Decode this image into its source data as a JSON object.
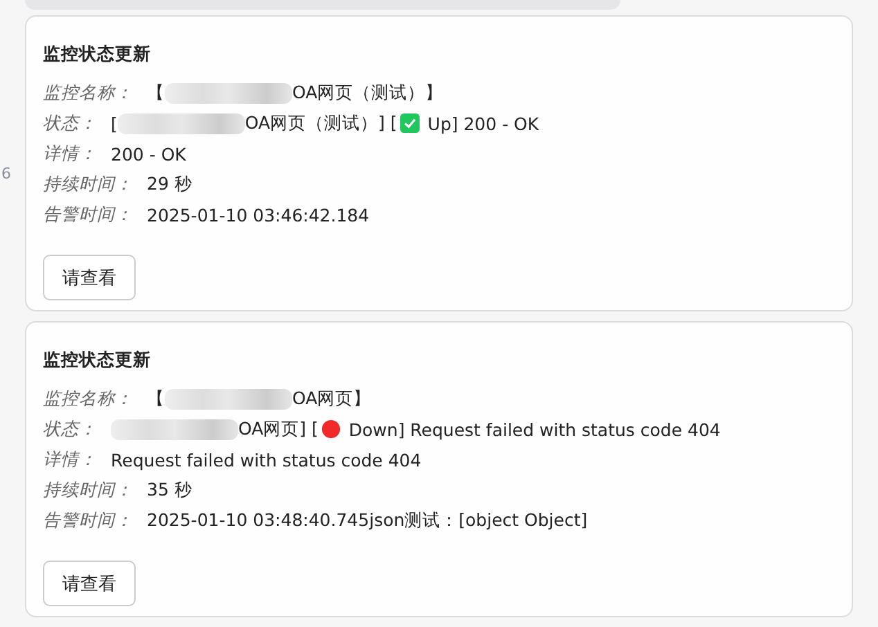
{
  "gutter_text": "6",
  "messages": [
    {
      "title": "监控状态更新",
      "button": "请查看",
      "rows": [
        {
          "label": "监控名称：",
          "parts": [
            {
              "kind": "text",
              "text": "【"
            },
            {
              "kind": "redacted"
            },
            {
              "kind": "text",
              "text": "OA网页（测试）】"
            }
          ]
        },
        {
          "label": "状态：",
          "parts": [
            {
              "kind": "text",
              "text": "["
            },
            {
              "kind": "redacted"
            },
            {
              "kind": "text",
              "text": "OA网页（测试）] ["
            },
            {
              "kind": "check"
            },
            {
              "kind": "text",
              "text": "Up] 200 - OK"
            }
          ]
        },
        {
          "label": "详情：",
          "parts": [
            {
              "kind": "text",
              "text": "200 - OK"
            }
          ]
        },
        {
          "label": "持续时间：",
          "parts": [
            {
              "kind": "text",
              "text": "29 秒"
            }
          ]
        },
        {
          "label": "告警时间：",
          "parts": [
            {
              "kind": "text",
              "text": "2025-01-10 03:46:42.184"
            }
          ]
        }
      ]
    },
    {
      "title": "监控状态更新",
      "button": "请查看",
      "rows": [
        {
          "label": "监控名称：",
          "parts": [
            {
              "kind": "text",
              "text": "【"
            },
            {
              "kind": "redacted"
            },
            {
              "kind": "text",
              "text": "OA网页】"
            }
          ]
        },
        {
          "label": "状态：",
          "parts": [
            {
              "kind": "redacted"
            },
            {
              "kind": "text",
              "text": "OA网页] ["
            },
            {
              "kind": "dot"
            },
            {
              "kind": "text",
              "text": "Down] Request failed with status code 404"
            }
          ]
        },
        {
          "label": "详情：",
          "parts": [
            {
              "kind": "text",
              "text": "Request failed with status code 404"
            }
          ]
        },
        {
          "label": "持续时间：",
          "parts": [
            {
              "kind": "text",
              "text": "35 秒"
            }
          ]
        },
        {
          "label": "告警时间：",
          "parts": [
            {
              "kind": "text",
              "text": "2025-01-10 03:48:40.745json测试：[object Object]"
            }
          ]
        }
      ]
    }
  ]
}
